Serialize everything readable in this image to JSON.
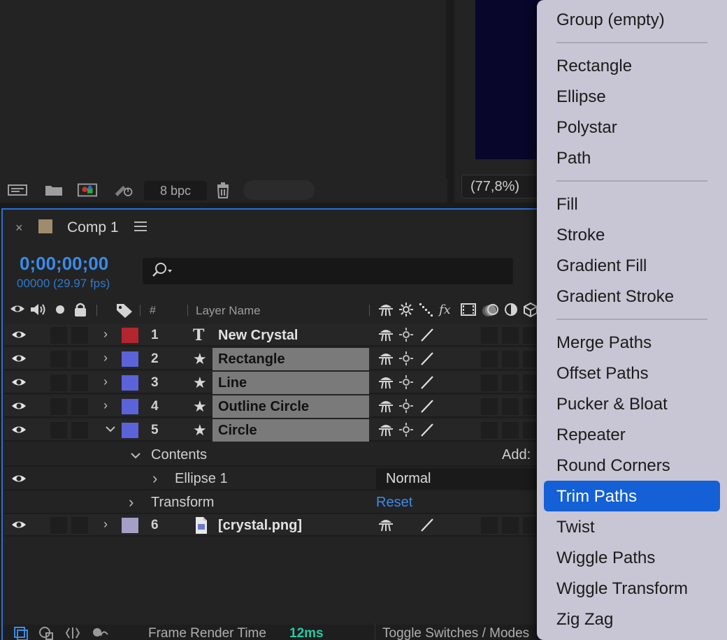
{
  "project": {
    "bpc": "8 bpc",
    "footer_icons": [
      "interpret-footage-icon",
      "new-folder-icon",
      "new-composition-icon",
      "render-queue-icon",
      "delete-icon"
    ]
  },
  "viewer": {
    "zoom": "(77,8%)"
  },
  "timeline": {
    "close_glyph": "×",
    "comp_name": "Comp 1",
    "timecode": "0;00;00;00",
    "frames": "00000 (29.97 fps)",
    "header": {
      "num": "#",
      "layer_name": "Layer Name"
    },
    "layers": [
      {
        "num": "1",
        "name": "New Crystal",
        "type_glyph": "T",
        "color": "#b3262f",
        "expanded": false,
        "selected": false
      },
      {
        "num": "2",
        "name": "Rectangle",
        "type_glyph": "★",
        "color": "#5c63d9",
        "expanded": false,
        "selected": true
      },
      {
        "num": "3",
        "name": "Line",
        "type_glyph": "★",
        "color": "#5c63d9",
        "expanded": false,
        "selected": true
      },
      {
        "num": "4",
        "name": "Outline Circle",
        "type_glyph": "★",
        "color": "#5c63d9",
        "expanded": false,
        "selected": true
      },
      {
        "num": "5",
        "name": "Circle",
        "type_glyph": "★",
        "color": "#5c63d9",
        "expanded": true,
        "selected": true
      }
    ],
    "contents_label": "Contents",
    "add_label": "Add:",
    "ellipse_label": "Ellipse 1",
    "blend_mode": "Normal",
    "transform_label": "Transform",
    "reset_label": "Reset",
    "layer6": {
      "num": "6",
      "name": "[crystal.png]",
      "color": "#a39fc6"
    },
    "frame_render_label": "Frame Render Time",
    "frame_render_value": "12ms",
    "toggle_label": "Toggle Switches / Modes"
  },
  "add_menu": {
    "groups": [
      [
        "Group (empty)"
      ],
      [
        "Rectangle",
        "Ellipse",
        "Polystar",
        "Path"
      ],
      [
        "Fill",
        "Stroke",
        "Gradient Fill",
        "Gradient Stroke"
      ],
      [
        "Merge Paths",
        "Offset Paths",
        "Pucker & Bloat",
        "Repeater",
        "Round Corners",
        "Trim Paths",
        "Twist",
        "Wiggle Paths",
        "Wiggle Transform",
        "Zig Zag"
      ]
    ],
    "highlighted": "Trim Paths",
    "highlight_color": "#1460d6"
  }
}
